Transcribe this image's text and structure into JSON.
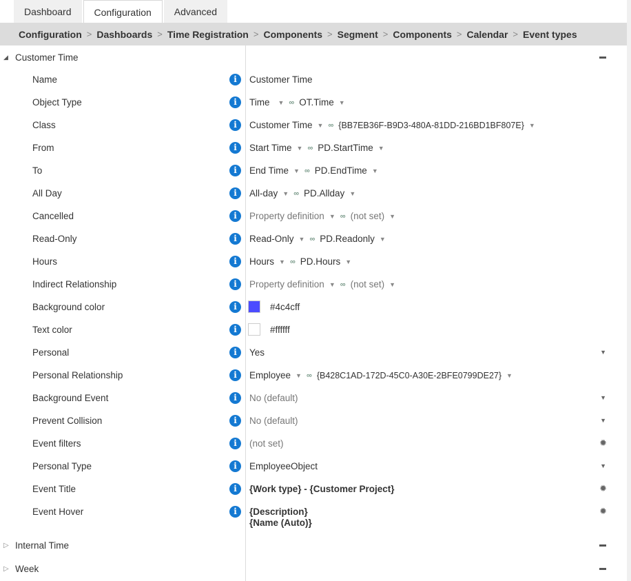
{
  "tabs": [
    {
      "label": "Dashboard",
      "active": false
    },
    {
      "label": "Configuration",
      "active": true
    },
    {
      "label": "Advanced",
      "active": false
    }
  ],
  "breadcrumb": [
    "Configuration",
    "Dashboards",
    "Time Registration",
    "Components",
    "Segment",
    "Components",
    "Calendar",
    "Event types"
  ],
  "breadcrumb_separator": ">",
  "groups": {
    "customer_time": {
      "label": "Customer Time",
      "expanded": true,
      "expander_icon": "triangle-down-icon",
      "collapse_icon": "minus-icon"
    },
    "internal_time": {
      "label": "Internal Time",
      "expanded": false,
      "expander_icon": "triangle-right-icon",
      "collapse_icon": "minus-icon"
    },
    "week": {
      "label": "Week",
      "expanded": false,
      "expander_icon": "triangle-right-icon",
      "collapse_icon": "minus-icon"
    }
  },
  "icons": {
    "info": "i",
    "dropdown": "▼",
    "link": "∞",
    "gear": "✹",
    "expanded": "◢",
    "collapsed": "▷"
  },
  "rows": {
    "name": {
      "label": "Name",
      "value": "Customer Time"
    },
    "object_type": {
      "label": "Object Type",
      "value": "Time",
      "link": "OT.Time"
    },
    "class": {
      "label": "Class",
      "value": "Customer Time",
      "link": "{BB7EB36F-B9D3-480A-81DD-216BD1BF807E}"
    },
    "from": {
      "label": "From",
      "value": "Start Time",
      "link": "PD.StartTime"
    },
    "to": {
      "label": "To",
      "value": "End Time",
      "link": "PD.EndTime"
    },
    "all_day": {
      "label": "All Day",
      "value": "All-day",
      "link": "PD.Allday"
    },
    "cancelled": {
      "label": "Cancelled",
      "value": "Property definition",
      "link": "(not set)"
    },
    "read_only": {
      "label": "Read-Only",
      "value": "Read-Only",
      "link": "PD.Readonly"
    },
    "hours": {
      "label": "Hours",
      "value": "Hours",
      "link": "PD.Hours"
    },
    "indirect_relationship": {
      "label": "Indirect Relationship",
      "value": "Property definition",
      "link": "(not set)"
    },
    "background_color": {
      "label": "Background color",
      "value": "#4c4cff",
      "swatch": "#4c4cff"
    },
    "text_color": {
      "label": "Text color",
      "value": "#ffffff",
      "swatch": "#ffffff"
    },
    "personal": {
      "label": "Personal",
      "value": "Yes"
    },
    "personal_relationship": {
      "label": "Personal Relationship",
      "value": "Employee",
      "link": "{B428C1AD-172D-45C0-A30E-2BFE0799DE27}"
    },
    "background_event": {
      "label": "Background Event",
      "value": "No (default)"
    },
    "prevent_collision": {
      "label": "Prevent Collision",
      "value": "No (default)"
    },
    "event_filters": {
      "label": "Event filters",
      "value": "(not set)"
    },
    "personal_type": {
      "label": "Personal Type",
      "value": "EmployeeObject"
    },
    "event_title": {
      "label": "Event Title",
      "value": "{Work type} - {Customer Project}"
    },
    "event_hover": {
      "label": "Event Hover",
      "value_line1": "{Description}",
      "value_line2": "{Name (Auto)}"
    }
  }
}
